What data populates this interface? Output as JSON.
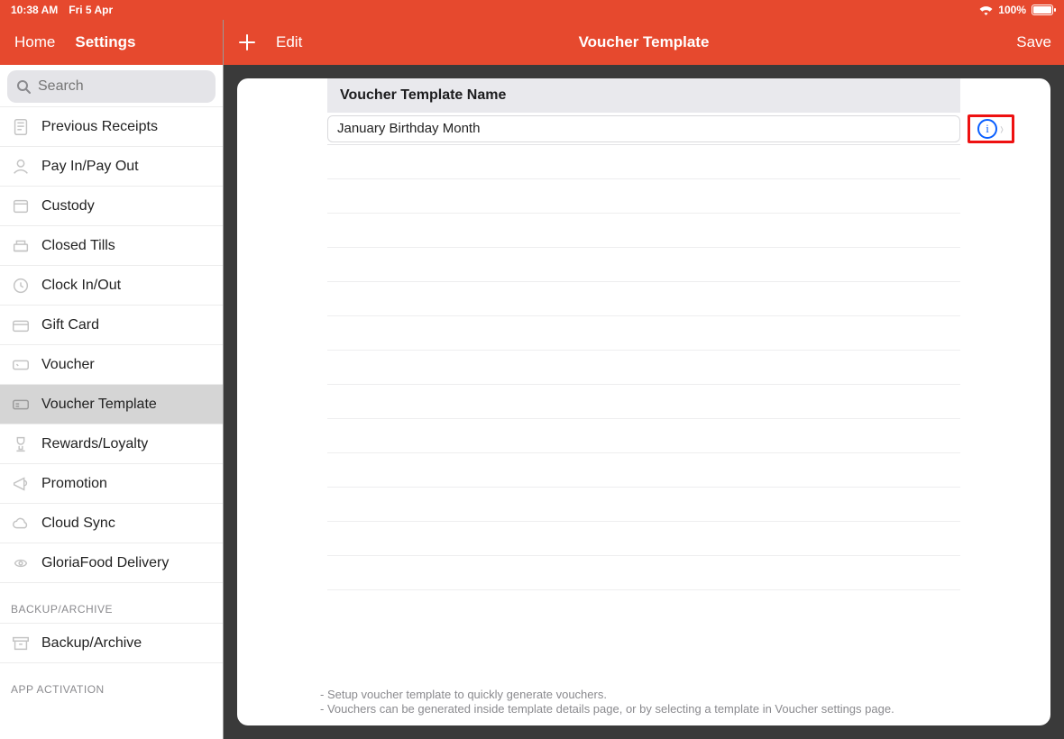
{
  "statusbar": {
    "time": "10:38 AM",
    "date": "Fri 5 Apr",
    "battery": "100%"
  },
  "sidebar": {
    "home": "Home",
    "settings": "Settings",
    "search_placeholder": "Search",
    "items": [
      {
        "label": "Previous Receipts"
      },
      {
        "label": "Pay In/Pay Out"
      },
      {
        "label": "Custody"
      },
      {
        "label": "Closed Tills"
      },
      {
        "label": "Clock In/Out"
      },
      {
        "label": "Gift Card"
      },
      {
        "label": "Voucher"
      },
      {
        "label": "Voucher Template"
      },
      {
        "label": "Rewards/Loyalty"
      },
      {
        "label": "Promotion"
      },
      {
        "label": "Cloud Sync"
      },
      {
        "label": "GloriaFood Delivery"
      }
    ],
    "section_backup": "BACKUP/ARCHIVE",
    "backup_item": "Backup/Archive",
    "section_activation": "APP ACTIVATION"
  },
  "main": {
    "add": "+",
    "edit": "Edit",
    "title": "Voucher Template",
    "save": "Save",
    "group_header": "Voucher Template Name",
    "template_value": "January Birthday Month",
    "notes": [
      "- Setup voucher template to quickly generate vouchers.",
      "- Vouchers can be generated inside template details page, or by selecting a template in Voucher settings page."
    ]
  }
}
